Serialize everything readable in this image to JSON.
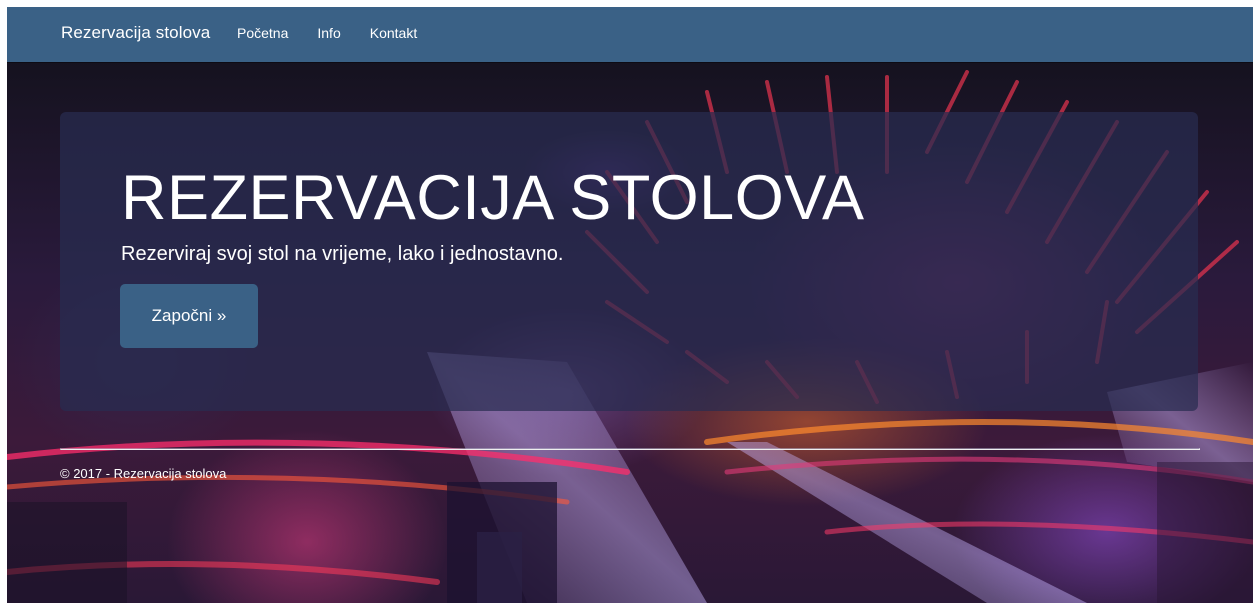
{
  "navbar": {
    "brand": "Rezervacija stolova",
    "links": [
      "Početna",
      "Info",
      "Kontakt"
    ]
  },
  "hero": {
    "title": "REZERVACIJA STOLOVA",
    "lead": "Rezerviraj svoj stol na vrijeme, lako i jednostavno.",
    "button_label": "Započni »"
  },
  "footer": {
    "copyright": "© 2017 - Rezervacija stolova"
  },
  "colors": {
    "navbar": "#3a6186",
    "button": "#3a6186",
    "text": "#ffffff",
    "jumbotron_overlay": "rgba(40, 44, 80, 0.72)"
  },
  "icons": []
}
